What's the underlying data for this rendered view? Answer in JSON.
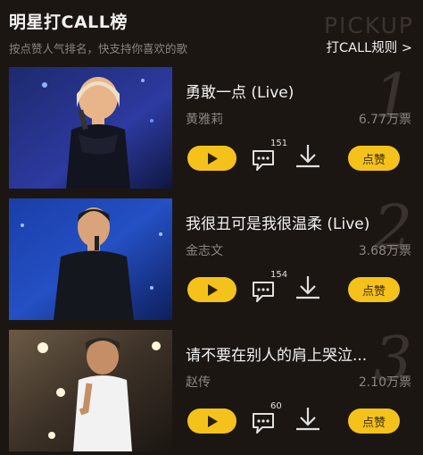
{
  "header": {
    "title": "明星打CALL榜",
    "subtitle": "按点赞人气排名，快支持你喜欢的歌",
    "watermark": "PICKUP",
    "rules_link": "打CALL规则 >"
  },
  "items": [
    {
      "rank": "1",
      "song": "勇敢一点 (Live)",
      "artist": "黄雅莉",
      "votes": "6.77万票",
      "comments": "151",
      "like_label": "点赞"
    },
    {
      "rank": "2",
      "song": "我很丑可是我很温柔 (Live)",
      "artist": "金志文",
      "votes": "3.68万票",
      "comments": "154",
      "like_label": "点赞"
    },
    {
      "rank": "3",
      "song": "请不要在别人的肩上哭泣...",
      "artist": "赵传",
      "votes": "2.10万票",
      "comments": "60",
      "like_label": "点赞"
    }
  ],
  "colors": {
    "accent": "#f4c21b",
    "background": "#1c1613"
  },
  "icons": [
    "play-icon",
    "comment-icon",
    "download-icon"
  ]
}
